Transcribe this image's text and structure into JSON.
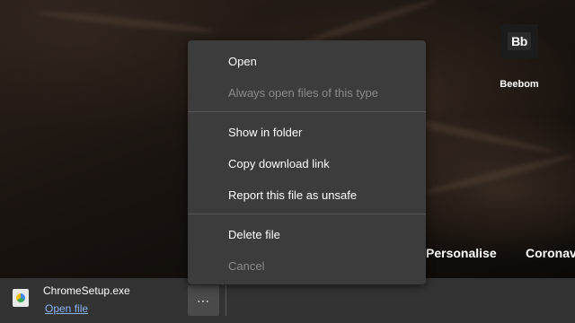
{
  "new_tab": {
    "shortcut_tile": {
      "logo_text": "Bb",
      "label": "Beebom"
    },
    "nav_links": [
      "Personalise",
      "Coronav"
    ]
  },
  "context_menu": {
    "items": [
      {
        "label": "Open",
        "enabled": true
      },
      {
        "label": "Always open files of this type",
        "enabled": false
      },
      {
        "label": "Show in folder",
        "enabled": true
      },
      {
        "label": "Copy download link",
        "enabled": true
      },
      {
        "label": "Report this file as unsafe",
        "enabled": true
      },
      {
        "label": "Delete file",
        "enabled": true
      },
      {
        "label": "Cancel",
        "enabled": false
      }
    ]
  },
  "download_shelf": {
    "file_name": "ChromeSetup.exe",
    "action_link": "Open file",
    "more_button_label": "⋮",
    "file_icon": "installer-file-icon"
  },
  "colors": {
    "menu_background": "#3c3c3c",
    "shelf_background": "#333333",
    "link": "#8ab4f8",
    "disabled_text": "#8a8a8a"
  }
}
